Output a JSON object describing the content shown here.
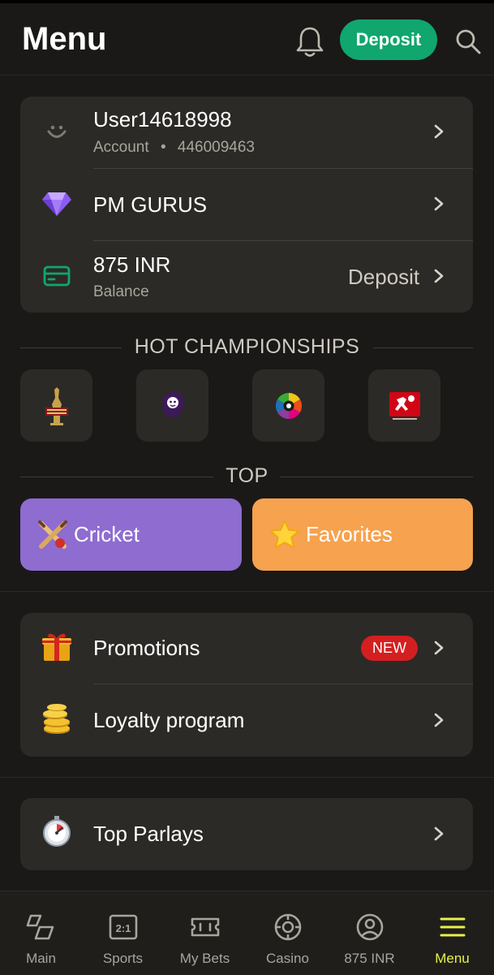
{
  "header": {
    "title": "Menu",
    "deposit_label": "Deposit"
  },
  "account": {
    "username": "User14618998",
    "account_label": "Account",
    "separator": "•",
    "account_id": "446009463",
    "status_label": "PM GURUS",
    "balance_value": "875 INR",
    "balance_label": "Balance",
    "deposit_link": "Deposit"
  },
  "hot_championships": {
    "title": "HOT CHAMPIONSHIPS",
    "items": [
      {
        "name": "IPL",
        "icon": "ipl-trophy-icon"
      },
      {
        "name": "Premier League",
        "icon": "premier-league-lion-icon"
      },
      {
        "name": "LaLiga",
        "icon": "laliga-ball-icon"
      },
      {
        "name": "Bundesliga",
        "icon": "bundesliga-icon"
      }
    ]
  },
  "top": {
    "title": "TOP",
    "cricket_label": "Cricket",
    "favorites_label": "Favorites"
  },
  "menu": {
    "promotions_label": "Promotions",
    "new_badge": "NEW",
    "loyalty_label": "Loyalty program",
    "parlays_label": "Top Parlays"
  },
  "nav": {
    "items": [
      {
        "label": "Main",
        "icon": "main-icon"
      },
      {
        "label": "Sports",
        "icon": "sports-icon"
      },
      {
        "label": "My Bets",
        "icon": "ticket-icon"
      },
      {
        "label": "Casino",
        "icon": "casino-chip-icon"
      },
      {
        "label": "875 INR",
        "icon": "account-icon"
      },
      {
        "label": "Menu",
        "icon": "menu-icon"
      }
    ],
    "active": "Menu"
  },
  "colors": {
    "background": "#1a1917",
    "card": "#2c2a26",
    "deposit_green": "#10a66e",
    "cricket_purple": "#8e6cd0",
    "favorites_orange": "#f6a24f",
    "badge_red": "#d41f21",
    "nav_active": "#e8f04a"
  }
}
